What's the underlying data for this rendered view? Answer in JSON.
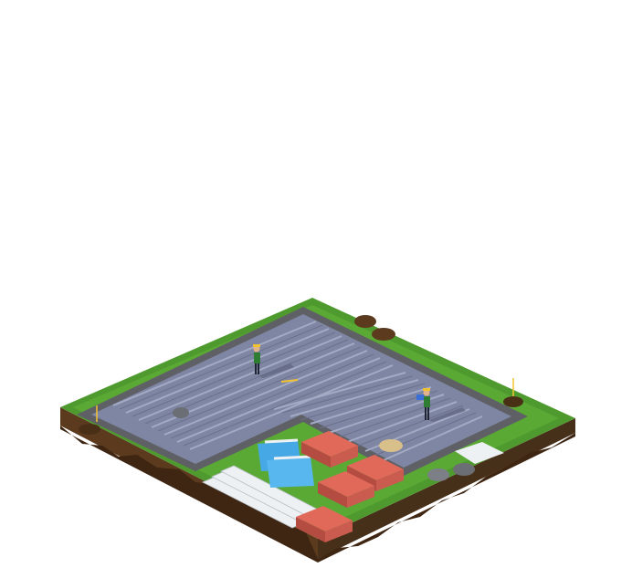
{
  "scene": {
    "title": "",
    "colors": {
      "background": "#ffffff",
      "grass_top": "#4f9a2f",
      "grass_light": "#67b83c",
      "dirt_side": "#5b3a1e",
      "dirt_dark": "#3f2612",
      "slab_border": "#5f6066",
      "slab_fill": "#7f86a3",
      "slab_rib": "#9aa1bd",
      "pallet_red": "#e0695a",
      "pallet_red_dark": "#b44c41",
      "glass_blue": "#47a8e6",
      "rail_white": "#eef1f4",
      "rock_gray": "#7d7f86",
      "rock_brown": "#5b3a1e",
      "sand": "#d9c08a",
      "worker_vest": "#2e7d32",
      "worker_helmet": "#f2c230"
    },
    "objects": {
      "workers": 2,
      "rebar_pallets": 4,
      "glass_panels": 2,
      "survey_stakes": 2,
      "rocks": 5
    }
  }
}
